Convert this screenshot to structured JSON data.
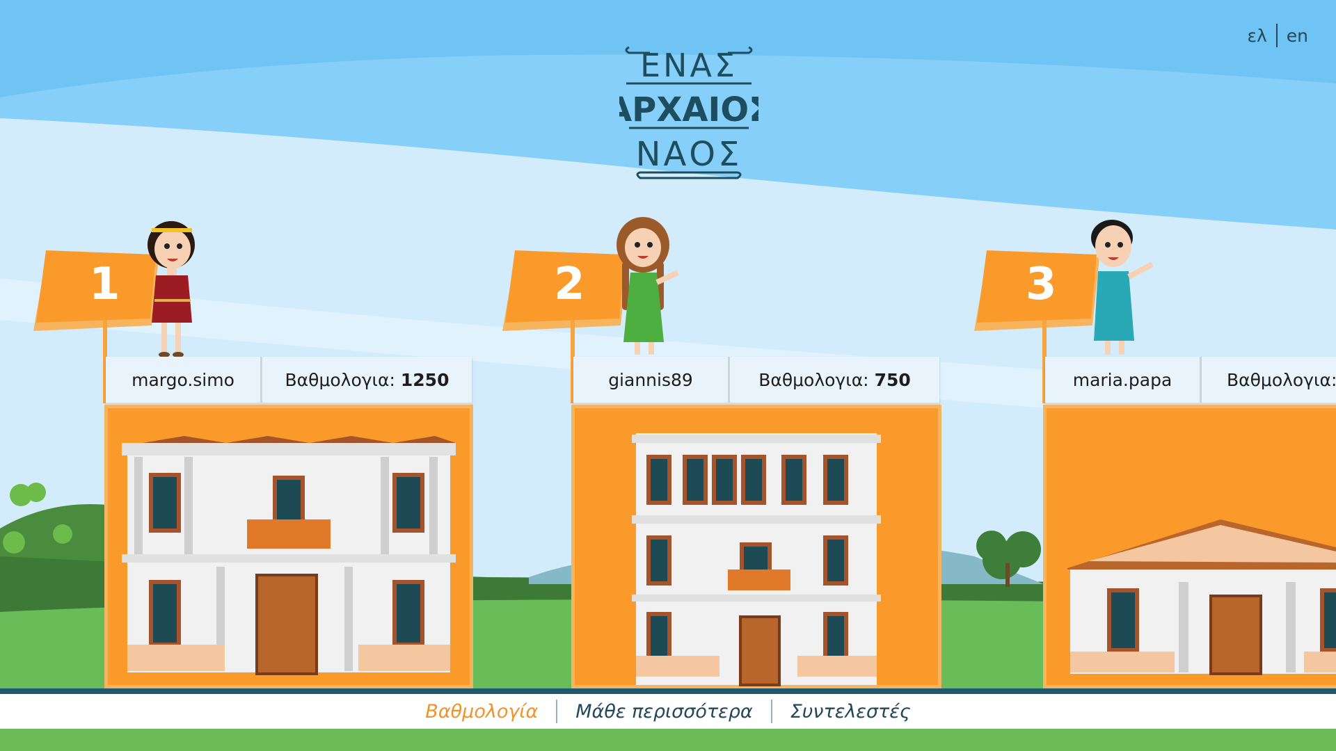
{
  "lang": {
    "el": "ελ",
    "en": "en"
  },
  "logo": {
    "line1": "ΕΝΑΣ",
    "line2": "ΑΡΧΑΙΟΣ",
    "line3": "ΝΑΟΣ"
  },
  "leaderboard": [
    {
      "rank": "1",
      "user": "margo.simo",
      "score_label": "Βαθμολογια:",
      "score": "1250"
    },
    {
      "rank": "2",
      "user": "giannis89",
      "score_label": "Βαθμολογια:",
      "score": "750"
    },
    {
      "rank": "3",
      "user": "maria.papa",
      "score_label": "Βαθμολογια:",
      "score": ""
    }
  ],
  "footer": {
    "items": [
      "Βαθμολογία",
      "Μάθε περισσότερα",
      "Συντελεστές"
    ]
  },
  "colors": {
    "accent": "#f99a2a",
    "dark": "#23485a",
    "sky": "#7ecbf7",
    "grass": "#6dbb58"
  }
}
